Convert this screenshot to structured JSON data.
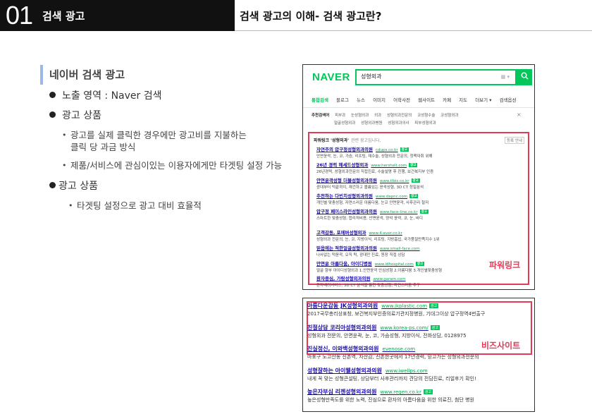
{
  "header": {
    "number": "01",
    "category": "검색 광고",
    "title": "검색 광고의 이해- 검색 광고란?"
  },
  "section": {
    "title": "네이버 검색 광고",
    "items": [
      {
        "text": "노출 영역 : Naver 검색"
      },
      {
        "text": "광고 상품"
      }
    ],
    "subitems": [
      {
        "line1": "광고를 실제 클릭한 경우에만 광고비를 지불하는",
        "line2": "클릭 당 과금 방식"
      },
      {
        "line1": "제품/서비스에 관심이있는 이용자에게만 타겟팅 설정 가능"
      }
    ],
    "item3": "광고 상품",
    "sub3": "타겟팅 설정으로 광고 대비 효율적"
  },
  "naver": {
    "logo": "NAVER",
    "query": "성형외과",
    "keyboard": "▦ ▾",
    "search_icon": "search-icon",
    "tabs": [
      "통합검색",
      "블로그",
      "뉴스",
      "이미지",
      "어학사전",
      "웹사이트",
      "카페",
      "지도",
      "더보기 ▾",
      "검색옵션"
    ],
    "related_label": "추천검색어",
    "related_row1": [
      "피부과",
      "눈성형외과",
      "외과",
      "성형외과전문의",
      "코성형수술",
      "코성형외과"
    ],
    "related_row2": [
      "얼굴성형외과",
      "성형외과병원",
      "성형외과의사",
      "피부성형외과"
    ],
    "powerlink_title": "파워링크 '성형외과'",
    "powerlink_sub": "관련 광고입니다.",
    "more": "등록 안내",
    "powerlink_ads": [
      {
        "title": "자연주의 압구정성형외과의원",
        "url": "cdups.co.kr",
        "desc": "안면윤곽, 눈, 코, 가슴, 리프팅, 재수술, 성형외과 전문의, 정맥마취 위해"
      },
      {
        "title": "26년 경력 헤세드성형외과",
        "url": "www.hershelt.com",
        "desc": "26년경력, 성형외과전문의 직접진료, 수술설명 후 진행, 보건복지부 인증"
      },
      {
        "title": "안면윤곽성형 더블성형외과의원",
        "url": "www.tlbis.co.kr",
        "desc": "광대부터 턱끝까지, 재건하고 볼륨있는 윤곽성형, 3D CT 정밀분석"
      },
      {
        "title": "추천하는 다빈치성형외과의원",
        "url": "www.dapnc.com",
        "desc": "개인별 맞춤성형, 자연스러운 아름다움, 눈코 안면윤곽, 사후관리 철저"
      },
      {
        "title": "압구정 페이스라인성형외과의원",
        "url": "www.face-line.co.kr",
        "desc": "스마트한 맞춤성형, 합리적비용, 안면윤곽, 양악 윤곽, 코, 눈, 바디"
      },
      {
        "title": "고객감동, 포에버성형외과",
        "url": "www.4-ever.co.kr",
        "desc": "성형외과 전문의, 눈, 코, 지방이식, 리프팅, 지방흡입, 국가품질만족지수 1위"
      },
      {
        "title": "믿음에는 적한얼굴성형외과의원",
        "url": "www.small-face.com",
        "desc": "나사없는 턱윤곽, 오직 턱, 광대만 진료, 원장 직접 상담"
      },
      {
        "title": "안면윤 아름다움, 아이디병원",
        "url": "www.idhospital.com",
        "desc": "얼굴 향부 아이디성형외과 1.안면윤곽 안심성형 2.아름다움 3.개인별맞춤성형"
      },
      {
        "title": "환자중심, 가람성형외과의원",
        "url": "www.garam.com",
        "desc": "환자배려서비스, 3D CT 분석을 통한 맞춤성형, 자연스러움 추구"
      }
    ],
    "powerlink_label": "파워링크"
  },
  "bizsite": {
    "ads": [
      {
        "title": "아름다운감동 JK성형외과의원",
        "url": "www.jkplastic.com",
        "desc": "2017국무총리상표창, 보건복지부인증의료기관지정병원, 기대그이상 압구정역4번출구"
      },
      {
        "title": "친절상담 코리아성형외과의원",
        "url": "www.korea-ps.com/",
        "desc": "성형외과 전문의, 안면윤곽, 눈, 코, 가슴성형, 지방이식, 전화상담, 0128975"
      },
      {
        "title": "진실정신, 이와백성형외과의원",
        "url": "evenose.com",
        "desc": "마포구 노고산동 신촌역, 자산감, 신촌한곳에서 17년경력, 믿고가는 성형외과전문의"
      },
      {
        "title": "성형잘하는 아이웰성형외과의원",
        "url": "www.iwellps.com",
        "desc": "내게 꼭 맞는 성형큰설팅, 상담부터 사후관리까지 견당의 전담진료, 리얼후기 확인!"
      },
      {
        "title": "높은자부심 리젠성형외과의원",
        "url": "www.regen.co.kr",
        "desc": "높은성형만족도를 위한 노력, 진심으로 환자의 아름다움을 위한 의료진, 첨단 병원"
      }
    ],
    "badge": "광고",
    "label": "비즈사이트"
  }
}
